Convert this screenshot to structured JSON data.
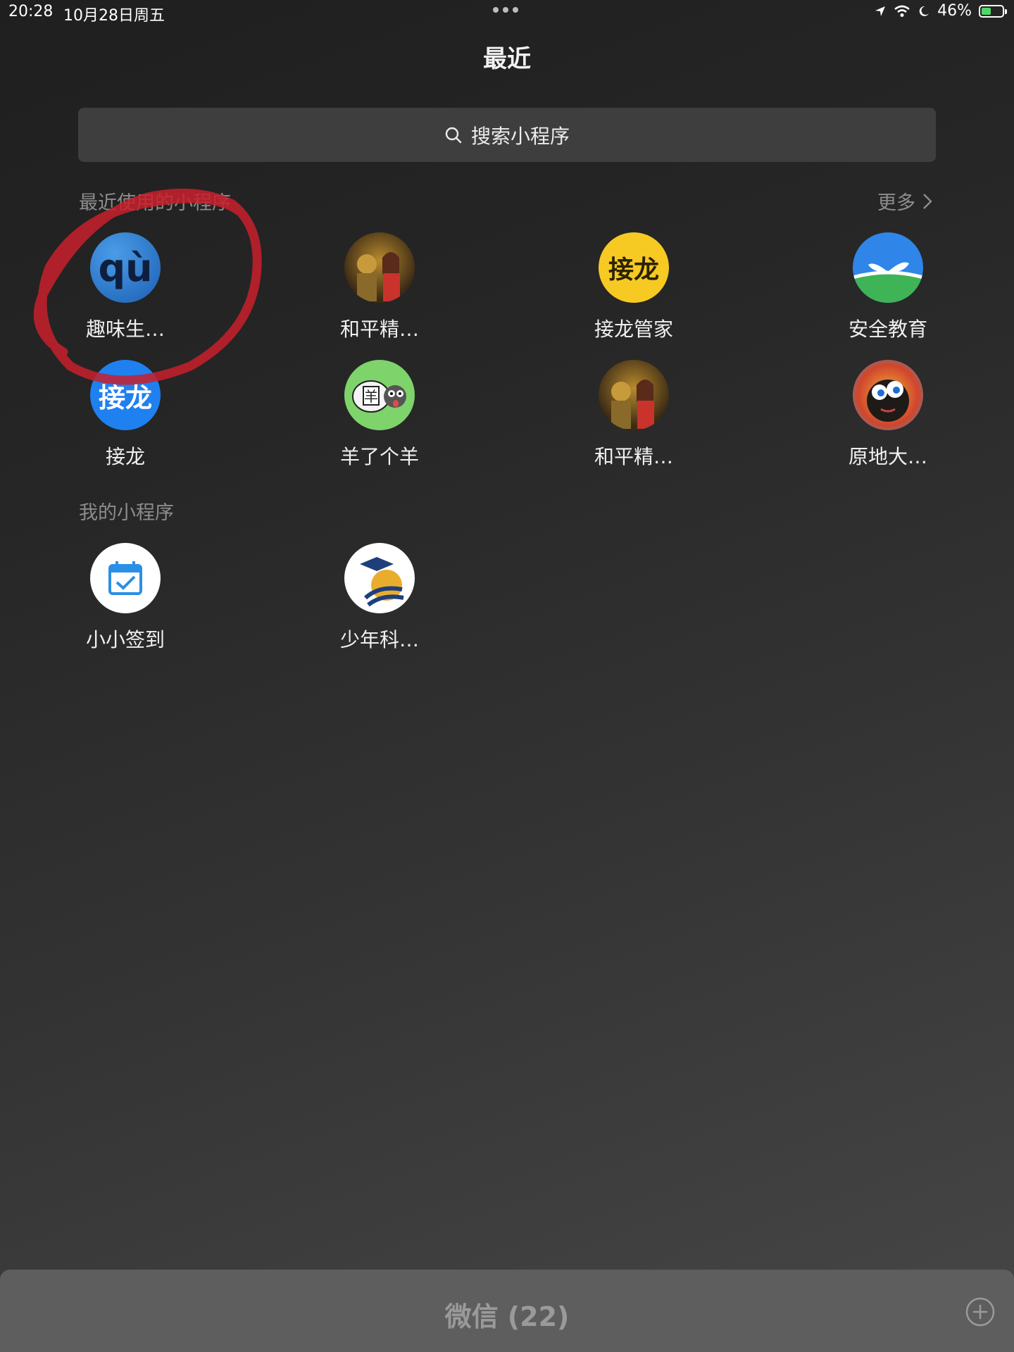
{
  "status_bar": {
    "time": "20:28",
    "date": "10月28日周五",
    "battery_percent": "46%",
    "battery_level": 0.46,
    "battery_color": "#4cd964"
  },
  "header": {
    "title": "最近"
  },
  "search": {
    "placeholder": "搜索小程序",
    "icon": "search-icon"
  },
  "recent_section": {
    "title": "最近使用的小程序",
    "more_label": "更多",
    "apps": [
      {
        "label": "趣味生…",
        "icon": "qu-icon",
        "glyph": "qù"
      },
      {
        "label": "和平精…",
        "icon": "game-character-icon"
      },
      {
        "label": "接龙管家",
        "icon": "jielong-guanjia-icon",
        "glyph": "接龙"
      },
      {
        "label": "安全教育",
        "icon": "sprout-icon"
      },
      {
        "label": "接龙",
        "icon": "jielong-icon",
        "glyph": "接龙"
      },
      {
        "label": "羊了个羊",
        "icon": "sheep-icon",
        "glyph": "羊"
      },
      {
        "label": "和平精…",
        "icon": "game-character-icon"
      },
      {
        "label": "原地大…",
        "icon": "bomb-character-icon"
      }
    ]
  },
  "my_section": {
    "title": "我的小程序",
    "apps": [
      {
        "label": "小小签到",
        "icon": "calendar-check-icon"
      },
      {
        "label": "少年科…",
        "icon": "graduation-cap-icon"
      }
    ]
  },
  "bottom_bar": {
    "title": "微信 (22)",
    "add_icon": "plus-circle-icon"
  },
  "colors": {
    "annotation": "#c8202b",
    "search_bg": "#3e3e3e",
    "section_text": "#8d8d8d"
  }
}
